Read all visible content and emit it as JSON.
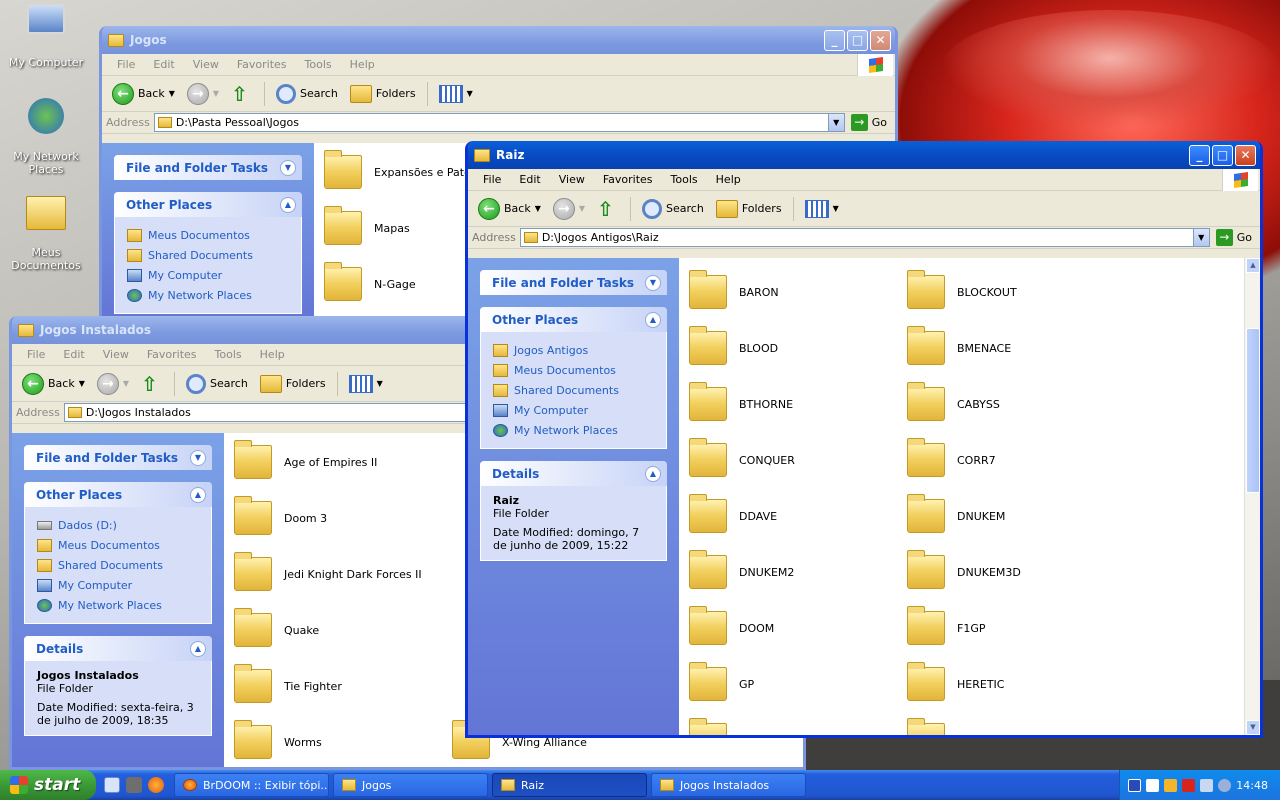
{
  "desktop": {
    "icons": [
      {
        "label": "My Computer"
      },
      {
        "label": "My Network Places"
      },
      {
        "label": "Meus Documentos"
      }
    ]
  },
  "menu": [
    "File",
    "Edit",
    "View",
    "Favorites",
    "Tools",
    "Help"
  ],
  "toolbar": {
    "back": "Back",
    "search": "Search",
    "folders": "Folders"
  },
  "address_label": "Address",
  "go_label": "Go",
  "win_jogos": {
    "title": "Jogos",
    "address": "D:\\Pasta Pessoal\\Jogos",
    "tasks_header": "File and Folder Tasks",
    "other_header": "Other Places",
    "other": [
      "Meus Documentos",
      "Shared Documents",
      "My Computer",
      "My Network Places"
    ],
    "files": [
      "Expansões e Patches",
      "Mapas",
      "N-Gage"
    ]
  },
  "win_inst": {
    "title": "Jogos Instalados",
    "address": "D:\\Jogos Instalados",
    "tasks_header": "File and Folder Tasks",
    "other_header": "Other Places",
    "other": [
      "Dados (D:)",
      "Meus Documentos",
      "Shared Documents",
      "My Computer",
      "My Network Places"
    ],
    "details_header": "Details",
    "details_name": "Jogos Instalados",
    "details_type": "File Folder",
    "details_date": "Date Modified: sexta-feira, 3 de julho de 2009, 18:35",
    "files": [
      "Age of Empires II",
      "Doom 3",
      "Jedi Knight Dark Forces II",
      "Quake",
      "Tie Fighter",
      "Worms"
    ],
    "files2": [
      "X-Wing Alliance"
    ]
  },
  "win_raiz": {
    "title": "Raiz",
    "address": "D:\\Jogos Antigos\\Raiz",
    "tasks_header": "File and Folder Tasks",
    "other_header": "Other Places",
    "other": [
      "Jogos Antigos",
      "Meus Documentos",
      "Shared Documents",
      "My Computer",
      "My Network Places"
    ],
    "details_header": "Details",
    "details_name": "Raiz",
    "details_type": "File Folder",
    "details_date": "Date Modified: domingo, 7 de junho de 2009, 15:22",
    "col1": [
      "BARON",
      "BLOOD",
      "BTHORNE",
      "CONQUER",
      "DDAVE",
      "DNUKEM2",
      "DOOM",
      "GP"
    ],
    "col2": [
      "BLOCKOUT",
      "BMENACE",
      "CABYSS",
      "CORR7",
      "DNUKEM",
      "DNUKEM3D",
      "F1GP",
      "HERETIC"
    ]
  },
  "taskbar": {
    "start": "start",
    "buttons": [
      "BrDOOM :: Exibir tópi...",
      "Jogos",
      "Raiz",
      "Jogos Instalados"
    ],
    "clock": "14:48"
  }
}
